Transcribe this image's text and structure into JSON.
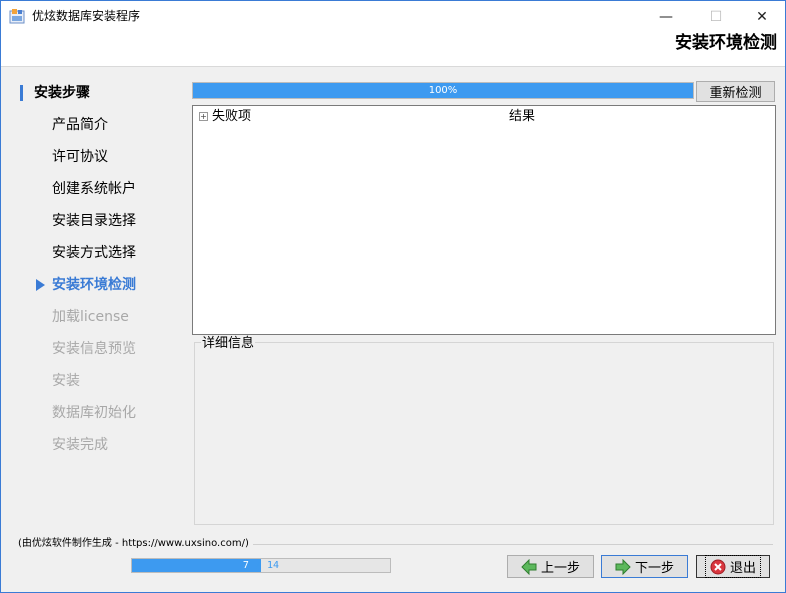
{
  "window": {
    "title": "优炫数据库安装程序",
    "heading": "安装环境检测",
    "controls": {
      "minimize": "—",
      "maximize": "☐",
      "close": "✕"
    }
  },
  "sidebar": {
    "header": "安装步骤",
    "steps": [
      {
        "label": "产品简介",
        "state": "done"
      },
      {
        "label": "许可协议",
        "state": "done"
      },
      {
        "label": "创建系统帐户",
        "state": "done"
      },
      {
        "label": "安装目录选择",
        "state": "done"
      },
      {
        "label": "安装方式选择",
        "state": "done"
      },
      {
        "label": "安装环境检测",
        "state": "current"
      },
      {
        "label": "加载license",
        "state": "pending"
      },
      {
        "label": "安装信息预览",
        "state": "pending"
      },
      {
        "label": "安装",
        "state": "pending"
      },
      {
        "label": "数据库初始化",
        "state": "pending"
      },
      {
        "label": "安装完成",
        "state": "pending"
      }
    ]
  },
  "main": {
    "progress": {
      "value": 100,
      "text": "100%"
    },
    "recheck_button": "重新检测",
    "table": {
      "expander": "+",
      "columns": [
        "失败项",
        "结果"
      ]
    },
    "detail_label": "详细信息"
  },
  "footer": {
    "credit": "(由优炫软件制作生成 - https://www.uxsino.com/)",
    "step_progress": {
      "current": 7,
      "total": 14,
      "separator": " / "
    },
    "prev_button": "上一步",
    "next_button": "下一步",
    "exit_button": "退出"
  },
  "colors": {
    "accent": "#3a7bd5",
    "progress_fill": "#3d9af0",
    "disabled_text": "#a8a8a8"
  }
}
